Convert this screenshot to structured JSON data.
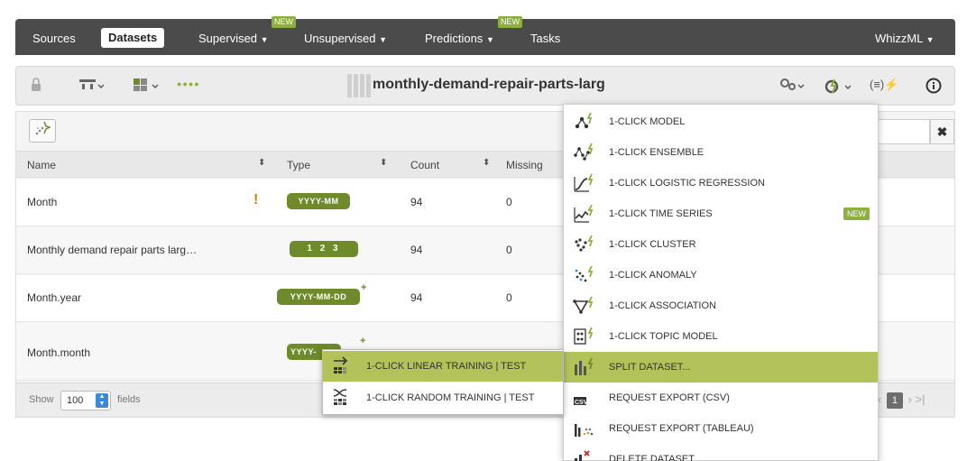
{
  "nav": {
    "items": [
      {
        "label": "Sources"
      },
      {
        "label": "Datasets"
      },
      {
        "label": "Supervised"
      },
      {
        "label": "Unsupervised"
      },
      {
        "label": "Predictions"
      },
      {
        "label": "Tasks"
      }
    ],
    "new_badge": "NEW",
    "user_menu": "WhizzML"
  },
  "toolbar": {
    "dataset_name": "monthly-demand-repair-parts-larg",
    "dots": "●●●●"
  },
  "table": {
    "headers": {
      "name": "Name",
      "type": "Type",
      "count": "Count",
      "missing": "Missing"
    },
    "rows": [
      {
        "name": "Month",
        "type": "YYYY-MM",
        "count": "94",
        "missing": "0"
      },
      {
        "name": "Monthly demand repair parts larg…",
        "type": "1 2 3",
        "count": "94",
        "missing": "0"
      },
      {
        "name": "Month.year",
        "type": "YYYY-MM-DD",
        "count": "94",
        "missing": "0"
      },
      {
        "name": "Month.month",
        "type": "YYYY-",
        "count": "",
        "missing": ""
      }
    ]
  },
  "footer": {
    "show_label": "Show",
    "page_size": "100",
    "fields_label": "fields",
    "current_page": "1"
  },
  "menu": {
    "items": [
      {
        "label": "1-CLICK MODEL",
        "icon": "model-icon"
      },
      {
        "label": "1-CLICK ENSEMBLE",
        "icon": "ensemble-icon"
      },
      {
        "label": "1-CLICK LOGISTIC REGRESSION",
        "icon": "logistic-regression-icon"
      },
      {
        "label": "1-CLICK TIME SERIES",
        "icon": "time-series-icon",
        "badge": "NEW"
      },
      {
        "label": "1-CLICK CLUSTER",
        "icon": "cluster-icon"
      },
      {
        "label": "1-CLICK ANOMALY",
        "icon": "anomaly-icon"
      },
      {
        "label": "1-CLICK ASSOCIATION",
        "icon": "association-icon"
      },
      {
        "label": "1-CLICK TOPIC MODEL",
        "icon": "topic-model-icon"
      },
      {
        "label": "SPLIT DATASET...",
        "icon": "split-dataset-icon"
      },
      {
        "label": "REQUEST EXPORT (CSV)",
        "icon": "csv-export-icon"
      },
      {
        "label": "REQUEST EXPORT (TABLEAU)",
        "icon": "tableau-export-icon"
      },
      {
        "label": "DELETE DATASET",
        "icon": "delete-dataset-icon"
      }
    ]
  },
  "submenu": {
    "items": [
      {
        "label": "1-CLICK LINEAR TRAINING | TEST",
        "icon": "linear-split-icon"
      },
      {
        "label": "1-CLICK RANDOM TRAINING | TEST",
        "icon": "random-split-icon"
      }
    ]
  },
  "colors": {
    "accent": "#8db03d",
    "highlight": "#b4c359",
    "type_badge": "#6f8a2a",
    "nav_bg": "#4b4b4b"
  }
}
